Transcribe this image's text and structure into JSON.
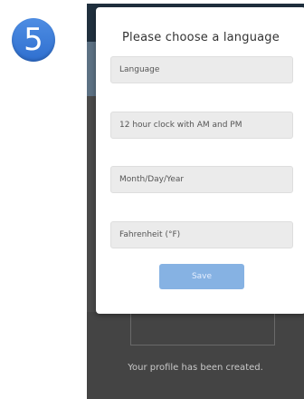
{
  "step": {
    "number": "5"
  },
  "modal": {
    "title": "Please choose a language",
    "fields": {
      "language": "Language",
      "clock": "12 hour clock with AM and PM",
      "date_format": "Month/Day/Year",
      "temperature": "Fahrenheit (°F)"
    },
    "save_label": "Save"
  },
  "background": {
    "status": "Your profile has been created."
  },
  "colors": {
    "badge": "#3a7bd5",
    "save_button": "#86b2e3",
    "overlay": "#4a4a4a"
  }
}
